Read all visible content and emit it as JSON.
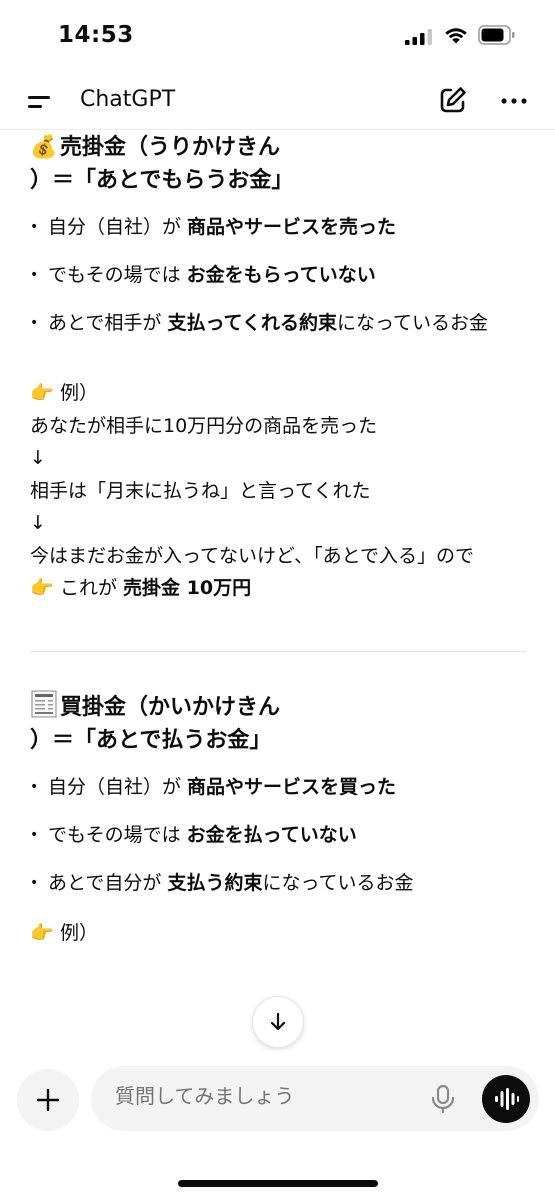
{
  "status_bar": {
    "time": "14:53"
  },
  "header": {
    "title": "ChatGPT"
  },
  "section1": {
    "icon": "money-bag-icon",
    "emoji": "💰",
    "heading_line1": "売掛金（うりかけきん",
    "heading_line2": "）＝「あとでもらうお金」",
    "bullets": [
      {
        "pre": "自分（自社）が ",
        "bold": "商品やサービスを売った",
        "post": ""
      },
      {
        "pre": "でもその場では ",
        "bold": "お金をもらっていない",
        "post": ""
      },
      {
        "pre": "あとで相手が ",
        "bold": "支払ってくれる約束",
        "post": "になっているお金"
      }
    ],
    "example_label": "例）",
    "example_lines": [
      "あなたが相手に10万円分の商品を売った",
      "↓",
      "相手は「月末に払うね」と言ってくれた",
      "↓",
      "今はまだお金が入ってないけど、「あとで入る」ので"
    ],
    "conclusion_pre": "これが ",
    "conclusion_bold": "売掛金 10万円"
  },
  "section2": {
    "icon": "receipt-icon",
    "heading_line1": "買掛金（かいかけきん",
    "heading_line2": "）＝「あとで払うお金」",
    "bullets": [
      {
        "pre": "自分（自社）が ",
        "bold": "商品やサービスを買った",
        "post": ""
      },
      {
        "pre": "でもその場では ",
        "bold": "お金を払っていない",
        "post": ""
      },
      {
        "pre": "あとで自分が ",
        "bold": "支払う約束",
        "post": "になっているお金"
      }
    ],
    "example_label": "例）"
  },
  "composer": {
    "placeholder": "質問してみましょう"
  },
  "hand_emoji": "👉"
}
